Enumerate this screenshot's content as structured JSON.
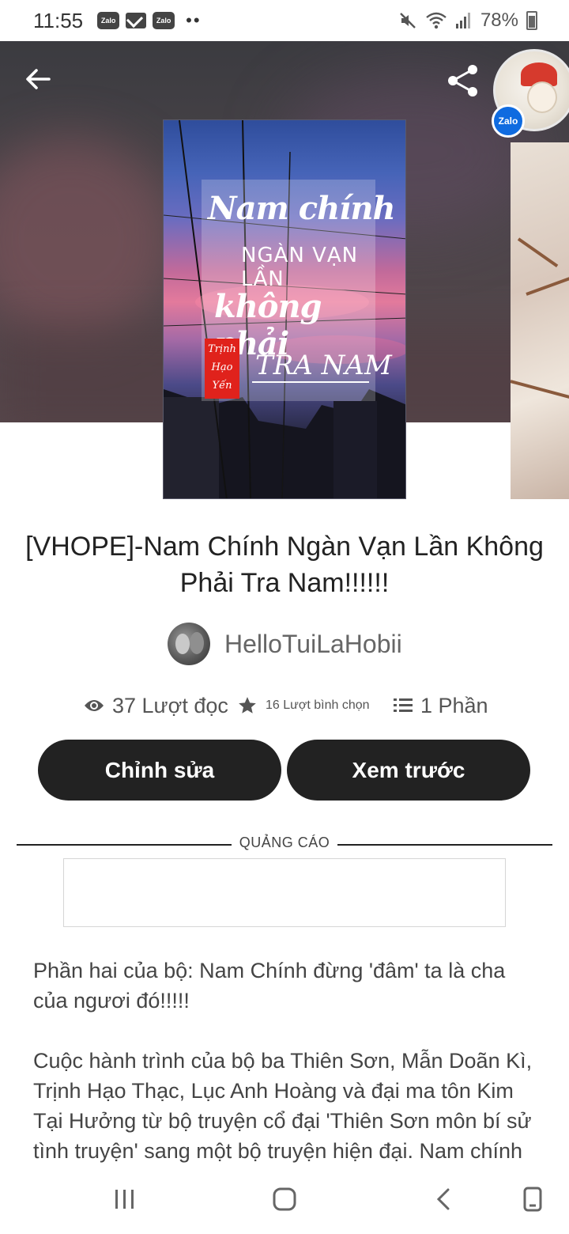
{
  "status_bar": {
    "time": "11:55",
    "notif_badges": [
      "Zalo",
      "Zalo"
    ],
    "battery": "78%"
  },
  "header": {
    "back_icon": "arrow-left-icon",
    "share_icon": "share-icon",
    "floating_bubble_badge": "Zalo"
  },
  "cover": {
    "line1": "Nam chính",
    "line2": "NGÀN VẠN LẦN",
    "line3": "không phải",
    "line4": "TRA NAM",
    "author_box": [
      "Trịnh",
      "Hạo",
      "Yến"
    ]
  },
  "story": {
    "title": "[VHOPE]-Nam Chính Ngàn Vạn Lần Không Phải Tra Nam!!!!!!",
    "author": "HelloTuiLaHobii"
  },
  "stats": {
    "reads": "37 Lượt đọc",
    "votes": "16 Lượt bình chọn",
    "parts": "1 Phần"
  },
  "actions": {
    "edit_label": "Chỉnh sửa",
    "preview_label": "Xem trước"
  },
  "ad": {
    "label": "QUẢNG CÁO"
  },
  "description": {
    "para1": "Phần hai của bộ: Nam Chính đừng 'đâm' ta là cha của ngươi đó!!!!!",
    "para2": "Cuộc hành trình của bộ ba Thiên Sơn, Mẫn Doãn Kì, Trịnh Hạo Thạc, Lục Anh Hoàng và đại ma tôn Kim Tại Hưởng từ bộ truyện cổ đại 'Thiên Sơn môn bí sử tình truyện' sang một bộ truyện hiện đại. Nam chính"
  },
  "nav_bar": {
    "icons": [
      "recent-apps-icon",
      "home-icon",
      "back-icon",
      "screen-icon"
    ]
  }
}
